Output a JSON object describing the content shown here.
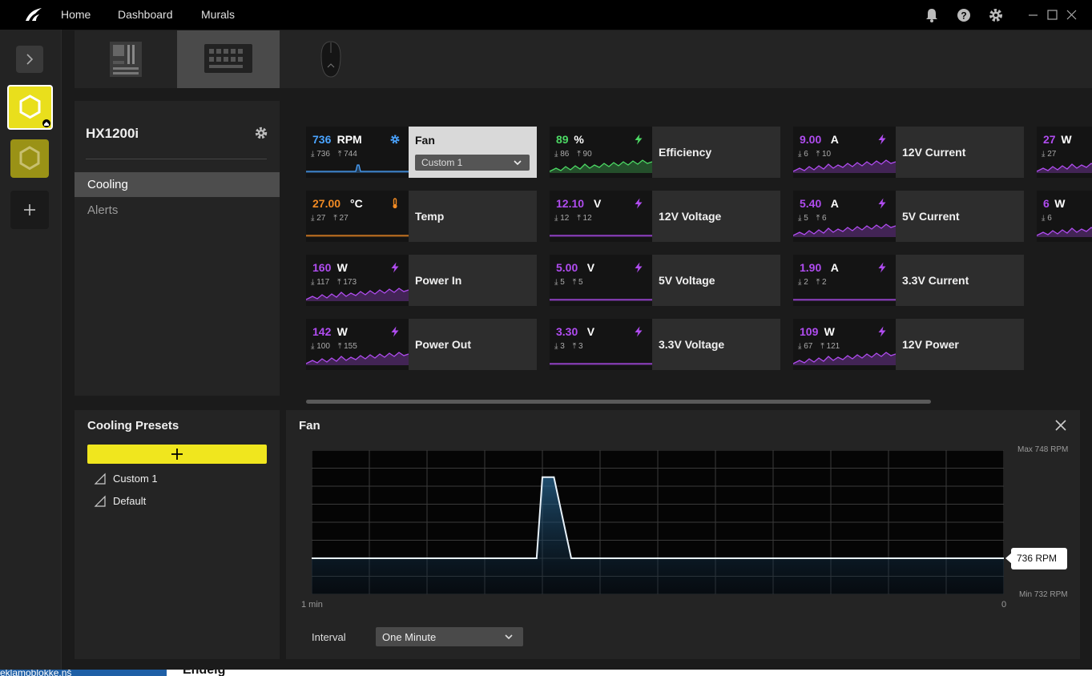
{
  "titlebar": {
    "nav": [
      "Home",
      "Dashboard",
      "Murals"
    ]
  },
  "device": {
    "name": "HX1200i"
  },
  "side_menu": [
    "Cooling",
    "Alerts"
  ],
  "tiles": [
    {
      "value": "736",
      "unit": "RPM",
      "min": "736",
      "max": "744",
      "label": "Fan",
      "color": "#4aa3ff",
      "icon": "gear-icon",
      "dropdown": "Custom 1"
    },
    {
      "value": "27.00",
      "unit": "°C",
      "min": "27",
      "max": "27",
      "label": "Temp",
      "color": "#f08a24",
      "icon": "thermometer-icon"
    },
    {
      "value": "160",
      "unit": "W",
      "min": "117",
      "max": "173",
      "label": "Power In",
      "color": "#b04cf0",
      "icon": "bolt-icon"
    },
    {
      "value": "142",
      "unit": "W",
      "min": "100",
      "max": "155",
      "label": "Power Out",
      "color": "#b04cf0",
      "icon": "bolt-icon"
    },
    {
      "value": "89",
      "unit": "%",
      "min": "86",
      "max": "90",
      "label": "Efficiency",
      "color": "#4cd964",
      "icon": "bolt-icon"
    },
    {
      "value": "12.10",
      "unit": "V",
      "min": "12",
      "max": "12",
      "label": "12V Voltage",
      "color": "#b04cf0",
      "icon": "bolt-icon"
    },
    {
      "value": "5.00",
      "unit": "V",
      "min": "5",
      "max": "5",
      "label": "5V Voltage",
      "color": "#b04cf0",
      "icon": "bolt-icon"
    },
    {
      "value": "3.30",
      "unit": "V",
      "min": "3",
      "max": "3",
      "label": "3.3V Voltage",
      "color": "#b04cf0",
      "icon": "bolt-icon"
    },
    {
      "value": "9.00",
      "unit": "A",
      "min": "6",
      "max": "10",
      "label": "12V Current",
      "color": "#b04cf0",
      "icon": "bolt-icon"
    },
    {
      "value": "5.40",
      "unit": "A",
      "min": "5",
      "max": "6",
      "label": "5V Current",
      "color": "#b04cf0",
      "icon": "bolt-icon"
    },
    {
      "value": "1.90",
      "unit": "A",
      "min": "2",
      "max": "2",
      "label": "3.3V Current",
      "color": "#b04cf0",
      "icon": "bolt-icon"
    },
    {
      "value": "109",
      "unit": "W",
      "min": "67",
      "max": "121",
      "label": "12V Power",
      "color": "#b04cf0",
      "icon": "bolt-icon"
    },
    {
      "value": "27",
      "unit": "W",
      "min": "27",
      "max": "",
      "label": "",
      "color": "#b04cf0",
      "icon": "bolt-icon"
    },
    {
      "value": "6",
      "unit": "W",
      "min": "6",
      "max": "",
      "label": "",
      "color": "#b04cf0",
      "icon": "bolt-icon"
    }
  ],
  "presets": {
    "title": "Cooling Presets",
    "items": [
      "Custom 1",
      "Default"
    ]
  },
  "fan_panel": {
    "title": "Fan",
    "max_label": "Max 748 RPM",
    "min_label": "Min 732 RPM",
    "current": "736 RPM",
    "x_start": "1 min",
    "x_end": "0",
    "interval_label": "Interval",
    "interval_value": "One Minute"
  },
  "chart_data": {
    "type": "area",
    "ylim": [
      732,
      748
    ],
    "x": [
      60,
      42,
      40.5,
      40,
      39,
      37.5,
      37,
      0
    ],
    "y": [
      736,
      736,
      736,
      745,
      745,
      736,
      736,
      736
    ],
    "xlabel": "",
    "ylabel": ""
  },
  "taskbar_fragment": {
    "left": "eklamoblokke.nš",
    "right": "Endeíg"
  },
  "accent": "#f0e61e"
}
